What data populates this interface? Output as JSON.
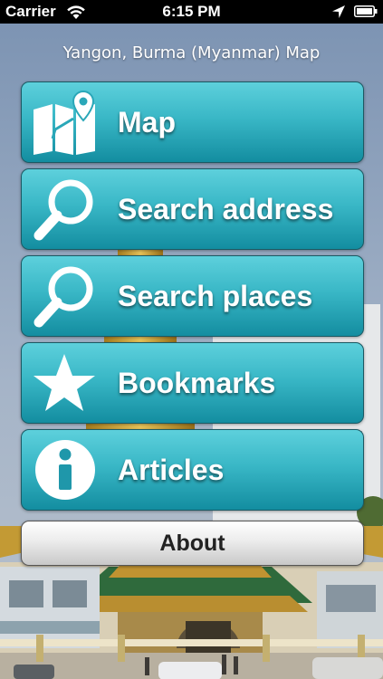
{
  "status_bar": {
    "carrier": "Carrier",
    "time": "6:15 PM",
    "icons": [
      "wifi-icon",
      "location-arrow-icon",
      "battery-icon"
    ]
  },
  "header": {
    "title": "Yangon, Burma (Myanmar) Map"
  },
  "menu": {
    "items": [
      {
        "label": "Map",
        "icon": "folded-map-icon"
      },
      {
        "label": "Search address",
        "icon": "magnifier-icon"
      },
      {
        "label": "Search places",
        "icon": "magnifier-icon"
      },
      {
        "label": "Bookmarks",
        "icon": "star-icon"
      },
      {
        "label": "Articles",
        "icon": "info-icon"
      }
    ],
    "about_label": "About"
  },
  "colors": {
    "button_top": "#5dd0dc",
    "button_bottom": "#138da0",
    "button_text": "#ffffff",
    "sky": "#8fa3bd",
    "gold": "#c9a23a"
  }
}
